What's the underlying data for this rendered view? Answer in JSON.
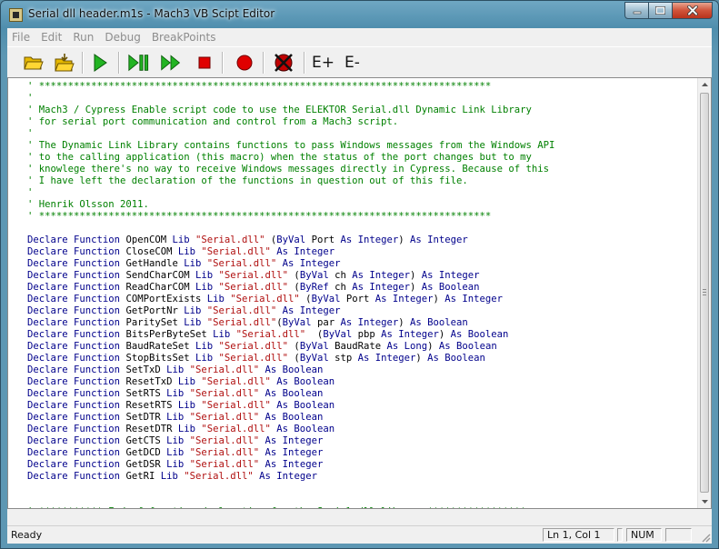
{
  "window": {
    "title": "Serial dll header.m1s - Mach3 VB Scipt Editor"
  },
  "menu": [
    "File",
    "Edit",
    "Run",
    "Debug",
    "BreakPoints"
  ],
  "toolbar": {
    "expand_label": "E+",
    "collapse_label": "E-"
  },
  "code_lines": [
    {
      "parts": [
        {
          "t": "' ******************************************************************************",
          "c": "c"
        }
      ]
    },
    {
      "parts": [
        {
          "t": "'",
          "c": "c"
        }
      ]
    },
    {
      "parts": [
        {
          "t": "' Mach3 / Cypress Enable script code to use the ELEKTOR Serial.dll Dynamic Link Library",
          "c": "c"
        }
      ]
    },
    {
      "parts": [
        {
          "t": "' for serial port communication and control from a Mach3 script.",
          "c": "c"
        }
      ]
    },
    {
      "parts": [
        {
          "t": "'",
          "c": "c"
        }
      ]
    },
    {
      "parts": [
        {
          "t": "' The Dynamic Link Library contains functions to pass Windows messages from the Windows API",
          "c": "c"
        }
      ]
    },
    {
      "parts": [
        {
          "t": "' to the calling application (this macro) when the status of the port changes but to my",
          "c": "c"
        }
      ]
    },
    {
      "parts": [
        {
          "t": "' knowlege there's no way to receive Windows messages directly in Cypress. Because of this",
          "c": "c"
        }
      ]
    },
    {
      "parts": [
        {
          "t": "' I have left the declaration of the functions in question out of this file.",
          "c": "c"
        }
      ]
    },
    {
      "parts": [
        {
          "t": "'",
          "c": "c"
        }
      ]
    },
    {
      "parts": [
        {
          "t": "' Henrik Olsson 2011.",
          "c": "c"
        }
      ]
    },
    {
      "parts": [
        {
          "t": "' ******************************************************************************",
          "c": "c"
        }
      ]
    },
    {
      "parts": []
    },
    {
      "parts": [
        {
          "t": "Declare Function ",
          "c": "k"
        },
        {
          "t": "OpenCOM ",
          "c": "n"
        },
        {
          "t": "Lib ",
          "c": "k"
        },
        {
          "t": "\"Serial.dll\"",
          "c": "s"
        },
        {
          "t": " (",
          "c": "n"
        },
        {
          "t": "ByVal ",
          "c": "k"
        },
        {
          "t": "Port ",
          "c": "n"
        },
        {
          "t": "As Integer",
          "c": "k"
        },
        {
          "t": ") ",
          "c": "n"
        },
        {
          "t": "As Integer",
          "c": "k"
        }
      ]
    },
    {
      "parts": [
        {
          "t": "Declare Function ",
          "c": "k"
        },
        {
          "t": "CloseCOM ",
          "c": "n"
        },
        {
          "t": "Lib ",
          "c": "k"
        },
        {
          "t": "\"Serial.dll\"",
          "c": "s"
        },
        {
          "t": " ",
          "c": "n"
        },
        {
          "t": "As Integer",
          "c": "k"
        }
      ]
    },
    {
      "parts": [
        {
          "t": "Declare Function ",
          "c": "k"
        },
        {
          "t": "GetHandle ",
          "c": "n"
        },
        {
          "t": "Lib ",
          "c": "k"
        },
        {
          "t": "\"Serial.dll\"",
          "c": "s"
        },
        {
          "t": " ",
          "c": "n"
        },
        {
          "t": "As Integer",
          "c": "k"
        }
      ]
    },
    {
      "parts": [
        {
          "t": "Declare Function ",
          "c": "k"
        },
        {
          "t": "SendCharCOM ",
          "c": "n"
        },
        {
          "t": "Lib ",
          "c": "k"
        },
        {
          "t": "\"Serial.dll\"",
          "c": "s"
        },
        {
          "t": " (",
          "c": "n"
        },
        {
          "t": "ByVal ",
          "c": "k"
        },
        {
          "t": "ch ",
          "c": "n"
        },
        {
          "t": "As Integer",
          "c": "k"
        },
        {
          "t": ") ",
          "c": "n"
        },
        {
          "t": "As Integer",
          "c": "k"
        }
      ]
    },
    {
      "parts": [
        {
          "t": "Declare Function ",
          "c": "k"
        },
        {
          "t": "ReadCharCOM ",
          "c": "n"
        },
        {
          "t": "Lib ",
          "c": "k"
        },
        {
          "t": "\"Serial.dll\"",
          "c": "s"
        },
        {
          "t": " (",
          "c": "n"
        },
        {
          "t": "ByRef ",
          "c": "k"
        },
        {
          "t": "ch ",
          "c": "n"
        },
        {
          "t": "As Integer",
          "c": "k"
        },
        {
          "t": ") ",
          "c": "n"
        },
        {
          "t": "As Boolean",
          "c": "k"
        }
      ]
    },
    {
      "parts": [
        {
          "t": "Declare Function ",
          "c": "k"
        },
        {
          "t": "COMPortExists ",
          "c": "n"
        },
        {
          "t": "Lib ",
          "c": "k"
        },
        {
          "t": "\"Serial.dll\"",
          "c": "s"
        },
        {
          "t": " (",
          "c": "n"
        },
        {
          "t": "ByVal ",
          "c": "k"
        },
        {
          "t": "Port ",
          "c": "n"
        },
        {
          "t": "As Integer",
          "c": "k"
        },
        {
          "t": ") ",
          "c": "n"
        },
        {
          "t": "As Integer",
          "c": "k"
        }
      ]
    },
    {
      "parts": [
        {
          "t": "Declare Function ",
          "c": "k"
        },
        {
          "t": "GetPortNr ",
          "c": "n"
        },
        {
          "t": "Lib ",
          "c": "k"
        },
        {
          "t": "\"Serial.dll\"",
          "c": "s"
        },
        {
          "t": " ",
          "c": "n"
        },
        {
          "t": "As Integer",
          "c": "k"
        }
      ]
    },
    {
      "parts": [
        {
          "t": "Declare Function ",
          "c": "k"
        },
        {
          "t": "ParitySet ",
          "c": "n"
        },
        {
          "t": "Lib ",
          "c": "k"
        },
        {
          "t": "\"Serial.dll\"",
          "c": "s"
        },
        {
          "t": "(",
          "c": "n"
        },
        {
          "t": "ByVal ",
          "c": "k"
        },
        {
          "t": "par ",
          "c": "n"
        },
        {
          "t": "As Integer",
          "c": "k"
        },
        {
          "t": ") ",
          "c": "n"
        },
        {
          "t": "As Boolean",
          "c": "k"
        }
      ]
    },
    {
      "parts": [
        {
          "t": "Declare Function ",
          "c": "k"
        },
        {
          "t": "BitsPerByteSet ",
          "c": "n"
        },
        {
          "t": "Lib ",
          "c": "k"
        },
        {
          "t": "\"Serial.dll\"",
          "c": "s"
        },
        {
          "t": "  (",
          "c": "n"
        },
        {
          "t": "ByVal ",
          "c": "k"
        },
        {
          "t": "pbp ",
          "c": "n"
        },
        {
          "t": "As Integer",
          "c": "k"
        },
        {
          "t": ") ",
          "c": "n"
        },
        {
          "t": "As Boolean",
          "c": "k"
        }
      ]
    },
    {
      "parts": [
        {
          "t": "Declare Function ",
          "c": "k"
        },
        {
          "t": "BaudRateSet ",
          "c": "n"
        },
        {
          "t": "Lib ",
          "c": "k"
        },
        {
          "t": "\"Serial.dll\"",
          "c": "s"
        },
        {
          "t": " (",
          "c": "n"
        },
        {
          "t": "ByVal ",
          "c": "k"
        },
        {
          "t": "BaudRate ",
          "c": "n"
        },
        {
          "t": "As Long",
          "c": "k"
        },
        {
          "t": ") ",
          "c": "n"
        },
        {
          "t": "As Boolean",
          "c": "k"
        }
      ]
    },
    {
      "parts": [
        {
          "t": "Declare Function ",
          "c": "k"
        },
        {
          "t": "StopBitsSet ",
          "c": "n"
        },
        {
          "t": "Lib ",
          "c": "k"
        },
        {
          "t": "\"Serial.dll\"",
          "c": "s"
        },
        {
          "t": " (",
          "c": "n"
        },
        {
          "t": "ByVal ",
          "c": "k"
        },
        {
          "t": "stp ",
          "c": "n"
        },
        {
          "t": "As Integer",
          "c": "k"
        },
        {
          "t": ") ",
          "c": "n"
        },
        {
          "t": "As Boolean",
          "c": "k"
        }
      ]
    },
    {
      "parts": [
        {
          "t": "Declare Function ",
          "c": "k"
        },
        {
          "t": "SetTxD ",
          "c": "n"
        },
        {
          "t": "Lib ",
          "c": "k"
        },
        {
          "t": "\"Serial.dll\"",
          "c": "s"
        },
        {
          "t": " ",
          "c": "n"
        },
        {
          "t": "As Boolean",
          "c": "k"
        }
      ]
    },
    {
      "parts": [
        {
          "t": "Declare Function ",
          "c": "k"
        },
        {
          "t": "ResetTxD ",
          "c": "n"
        },
        {
          "t": "Lib ",
          "c": "k"
        },
        {
          "t": "\"Serial.dll\"",
          "c": "s"
        },
        {
          "t": " ",
          "c": "n"
        },
        {
          "t": "As Boolean",
          "c": "k"
        }
      ]
    },
    {
      "parts": [
        {
          "t": "Declare Function ",
          "c": "k"
        },
        {
          "t": "SetRTS ",
          "c": "n"
        },
        {
          "t": "Lib ",
          "c": "k"
        },
        {
          "t": "\"Serial.dll\"",
          "c": "s"
        },
        {
          "t": " ",
          "c": "n"
        },
        {
          "t": "As Boolean",
          "c": "k"
        }
      ]
    },
    {
      "parts": [
        {
          "t": "Declare Function ",
          "c": "k"
        },
        {
          "t": "ResetRTS ",
          "c": "n"
        },
        {
          "t": "Lib ",
          "c": "k"
        },
        {
          "t": "\"Serial.dll\"",
          "c": "s"
        },
        {
          "t": " ",
          "c": "n"
        },
        {
          "t": "As Boolean",
          "c": "k"
        }
      ]
    },
    {
      "parts": [
        {
          "t": "Declare Function ",
          "c": "k"
        },
        {
          "t": "SetDTR ",
          "c": "n"
        },
        {
          "t": "Lib ",
          "c": "k"
        },
        {
          "t": "\"Serial.dll\"",
          "c": "s"
        },
        {
          "t": " ",
          "c": "n"
        },
        {
          "t": "As Boolean",
          "c": "k"
        }
      ]
    },
    {
      "parts": [
        {
          "t": "Declare Function ",
          "c": "k"
        },
        {
          "t": "ResetDTR ",
          "c": "n"
        },
        {
          "t": "Lib ",
          "c": "k"
        },
        {
          "t": "\"Serial.dll\"",
          "c": "s"
        },
        {
          "t": " ",
          "c": "n"
        },
        {
          "t": "As Boolean",
          "c": "k"
        }
      ]
    },
    {
      "parts": [
        {
          "t": "Declare Function ",
          "c": "k"
        },
        {
          "t": "GetCTS ",
          "c": "n"
        },
        {
          "t": "Lib ",
          "c": "k"
        },
        {
          "t": "\"Serial.dll\"",
          "c": "s"
        },
        {
          "t": " ",
          "c": "n"
        },
        {
          "t": "As Integer",
          "c": "k"
        }
      ]
    },
    {
      "parts": [
        {
          "t": "Declare Function ",
          "c": "k"
        },
        {
          "t": "GetDCD ",
          "c": "n"
        },
        {
          "t": "Lib ",
          "c": "k"
        },
        {
          "t": "\"Serial.dll\"",
          "c": "s"
        },
        {
          "t": " ",
          "c": "n"
        },
        {
          "t": "As Integer",
          "c": "k"
        }
      ]
    },
    {
      "parts": [
        {
          "t": "Declare Function ",
          "c": "k"
        },
        {
          "t": "GetDSR ",
          "c": "n"
        },
        {
          "t": "Lib ",
          "c": "k"
        },
        {
          "t": "\"Serial.dll\"",
          "c": "s"
        },
        {
          "t": " ",
          "c": "n"
        },
        {
          "t": "As Integer",
          "c": "k"
        }
      ]
    },
    {
      "parts": [
        {
          "t": "Declare Function ",
          "c": "k"
        },
        {
          "t": "GetRI ",
          "c": "n"
        },
        {
          "t": "Lib ",
          "c": "k"
        },
        {
          "t": "\"Serial.dll\"",
          "c": "s"
        },
        {
          "t": " ",
          "c": "n"
        },
        {
          "t": "As Integer",
          "c": "k"
        }
      ]
    },
    {
      "parts": []
    },
    {
      "parts": []
    },
    {
      "parts": [
        {
          "t": "' *********** End of function declaration for the Serial.dll library *****************",
          "c": "c"
        }
      ]
    }
  ],
  "status": {
    "text": "Ready",
    "position": "Ln 1, Col 1",
    "num": "NUM"
  },
  "colors": {
    "comment": "#008000",
    "keyword": "#00008b",
    "string": "#b01010"
  }
}
